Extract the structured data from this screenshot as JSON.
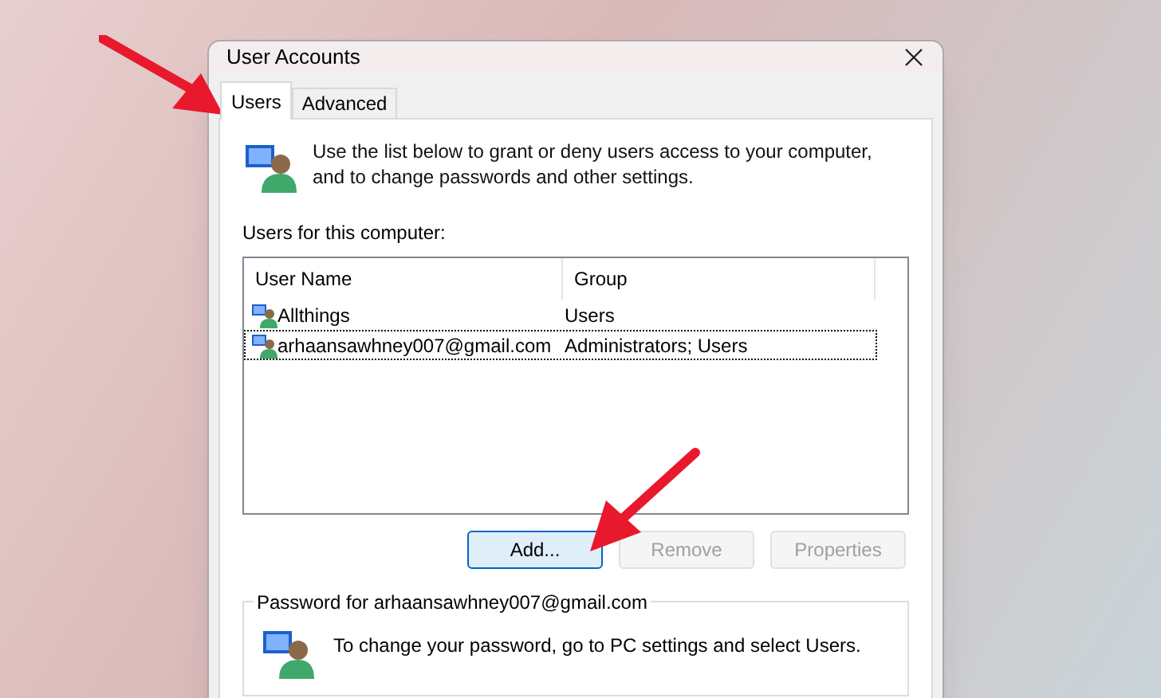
{
  "window": {
    "title": "User Accounts"
  },
  "tabs": [
    {
      "label": "Users",
      "selected": true
    },
    {
      "label": "Advanced",
      "selected": false
    }
  ],
  "intro": "Use the list below to grant or deny users access to your computer, and to change passwords and other settings.",
  "users_label": "Users for this computer:",
  "table": {
    "columns": [
      "User Name",
      "Group"
    ],
    "rows": [
      {
        "name": "Allthings",
        "group": "Users",
        "selected": false
      },
      {
        "name": "arhaansawhney007@gmail.com",
        "group": "Administrators; Users",
        "selected": true
      }
    ]
  },
  "buttons": [
    {
      "label": "Add...",
      "disabled": false,
      "default": true
    },
    {
      "label": "Remove",
      "disabled": true,
      "default": false
    },
    {
      "label": "Properties",
      "disabled": true,
      "default": false
    }
  ],
  "password_group": {
    "title": "Password for arhaansawhney007@gmail.com",
    "text": "To change your password, go to PC settings and select Users."
  }
}
